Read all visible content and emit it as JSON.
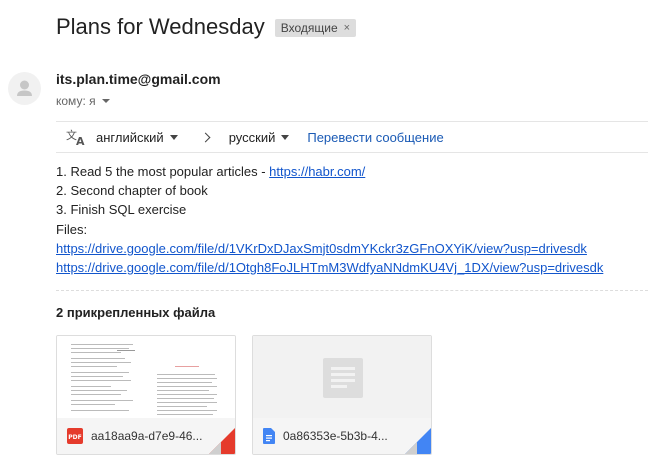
{
  "email": {
    "subject": "Plans for Wednesday",
    "label": "Входящие",
    "label_close": "×",
    "sender": "its.plan.time@gmail.com",
    "to": "кому: я"
  },
  "translate": {
    "from_language": "английский",
    "to_language": "русский",
    "action": "Перевести сообщение"
  },
  "body": {
    "line1_text": "1. Read 5 the most popular articles - ",
    "line1_link": "https://habr.com/",
    "line2": "2. Second chapter of book",
    "line3": "3. Finish SQL exercise",
    "line4": "Files:",
    "link1": "https://drive.google.com/file/d/1VKrDxDJaxSmjt0sdmYKckr3zGFnOXYiK/view?usp=drivesdk",
    "link2": "https://drive.google.com/file/d/1Otgh8FoJLHTmM3WdfyaNNdmKU4Vj_1DX/view?usp=drivesdk"
  },
  "attachments": {
    "title": "2 прикрепленных файла",
    "items": [
      {
        "name": "aa18aa9a-d7e9-46...",
        "type_icon": "pdf-icon",
        "accent": "#e53b2c"
      },
      {
        "name": "0a86353e-5b3b-4...",
        "type_icon": "google-docs-icon",
        "accent": "#4285f4"
      }
    ]
  },
  "colors": {
    "link": "#1155cc",
    "label_bg": "#dddddd",
    "pdf_red": "#e53b2c",
    "docs_blue": "#4285f4"
  }
}
